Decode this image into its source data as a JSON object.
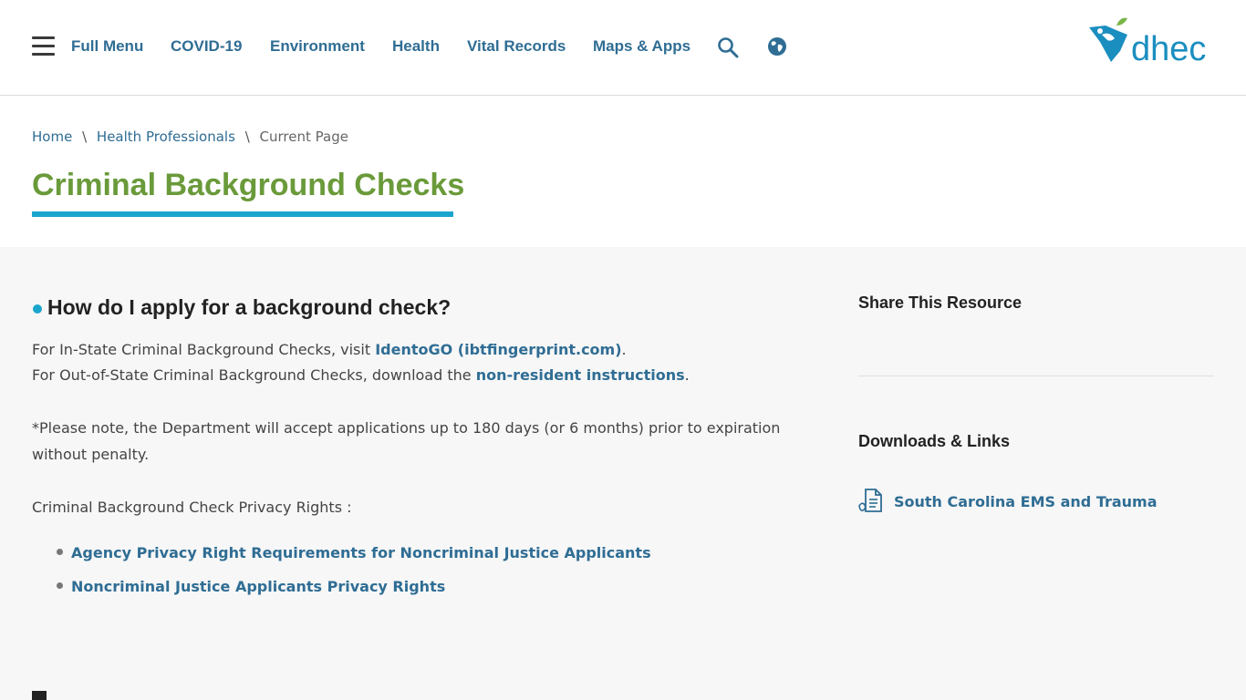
{
  "nav": {
    "full_menu": "Full Menu",
    "items": [
      "COVID-19",
      "Environment",
      "Health",
      "Vital Records",
      "Maps & Apps"
    ],
    "search_icon": "search-icon",
    "language_icon": "globe-icon"
  },
  "logo": {
    "text": "dhec"
  },
  "breadcrumb": {
    "home": "Home",
    "parent": "Health Professionals",
    "current": "Current Page",
    "separator": "\\"
  },
  "page": {
    "title": "Criminal Background Checks"
  },
  "content": {
    "heading": "How do I apply for a background check?",
    "line1_text": "For In-State Criminal Background Checks, visit ",
    "line1_link": "IdentoGO (ibtfingerprint.com)",
    "line1_end": ".",
    "line2_text": "For Out-of-State Criminal Background Checks, download the ",
    "line2_link": "non-resident instructions",
    "line2_end": ".",
    "note_line1": "*Please note, the Department will accept applications up to 180 days (or 6 months) prior to expiration",
    "note_line2": "without penalty.",
    "privacy_label": "Criminal Background Check Privacy Rights :",
    "privacy_links": [
      "Agency Privacy Right Requirements for Noncriminal Justice Applicants",
      "Noncriminal Justice Applicants Privacy Rights"
    ]
  },
  "sidebar": {
    "share_heading": "Share This Resource",
    "downloads_heading": "Downloads & Links",
    "links": [
      "South Carolina EMS and Trauma"
    ]
  },
  "colors": {
    "link": "#2f6d94",
    "title_green": "#6a9a3a",
    "accent_blue": "#1ba5cd",
    "content_bg": "#f7f7f7"
  }
}
